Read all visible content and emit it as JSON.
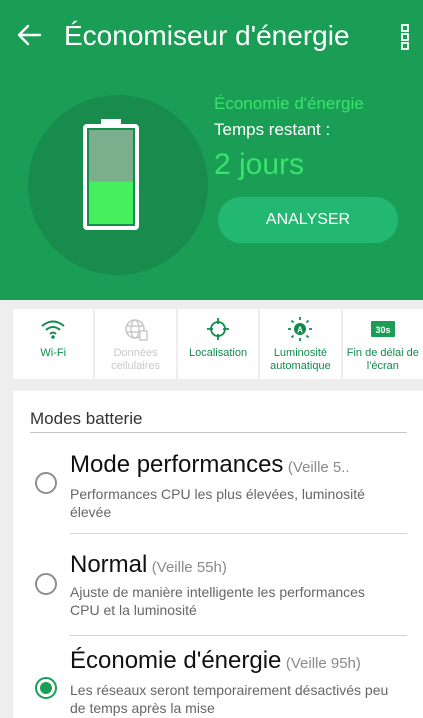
{
  "header": {
    "title": "Économiseur d'énergie",
    "back_icon": "back-arrow-icon",
    "menu_icon": "more-vert-icon"
  },
  "status": {
    "mode_label": "Économie d'énergie",
    "time_label": "Temps restant :",
    "time_value": "2 jours",
    "battery_level": 0.45,
    "analyze_button": "ANALYSER"
  },
  "quick_settings": [
    {
      "label": "Wi-Fi",
      "icon": "wifi-icon",
      "enabled": true
    },
    {
      "label": "Données cellulaires",
      "icon": "globe-icon",
      "enabled": false
    },
    {
      "label": "Localisation",
      "icon": "location-icon",
      "enabled": true
    },
    {
      "label": "Luminosité automatique",
      "icon": "brightness-icon",
      "enabled": true
    },
    {
      "label": "Fin de délai de l'écran",
      "icon": "timeout-icon",
      "enabled": true,
      "badge": "30s"
    }
  ],
  "modes": {
    "title": "Modes batterie",
    "items": [
      {
        "name": "Mode performances",
        "standby": "(Veille 5..",
        "description": "Performances CPU les plus élevées, luminosité élevée",
        "selected": false
      },
      {
        "name": "Normal",
        "standby": "(Veille 55h)",
        "description": "Ajuste de manière intelligente les performances CPU et la luminosité",
        "selected": false
      },
      {
        "name": "Économie d'énergie",
        "standby": "(Veille 95h)",
        "description": "Les réseaux seront temporairement désactivés peu de temps après la mise",
        "selected": true
      }
    ]
  },
  "colors": {
    "primary": "#1a9e56",
    "accent": "#39e46c",
    "button": "#23b871"
  }
}
